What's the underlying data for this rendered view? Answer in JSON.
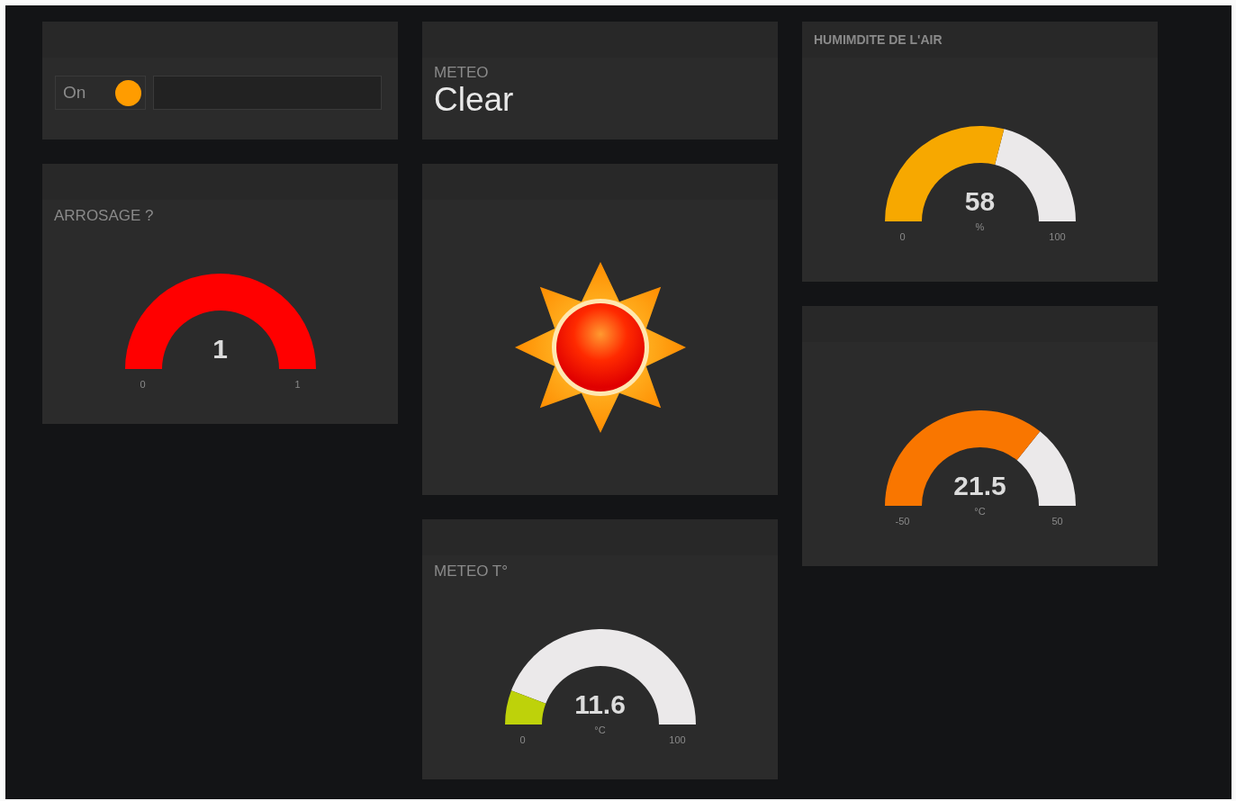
{
  "columns": [
    {
      "cards": [
        {
          "kind": "switch",
          "label": "On",
          "on": true
        },
        {
          "kind": "gauge",
          "title": "ARROSAGE ?",
          "value": "1",
          "min": "0",
          "max": "1",
          "color": "#ff0000"
        }
      ]
    },
    {
      "cards": [
        {
          "kind": "text",
          "label": "METEO",
          "value": "Clear"
        },
        {
          "kind": "weather_icon"
        },
        {
          "kind": "gauge",
          "title": "METEO T°",
          "value": "11.6",
          "unit": "°C",
          "min": "0",
          "max": "100",
          "color": "#bed20a"
        }
      ]
    },
    {
      "cards": [
        {
          "kind": "gauge",
          "header": "HUMIMDITE DE L'AIR",
          "value": "58",
          "unit": "%",
          "min": "0",
          "max": "100",
          "color": "#f7a800"
        },
        {
          "kind": "gauge",
          "value": "21.5",
          "unit": "°C",
          "min": "-50",
          "max": "50",
          "color": "#f97600"
        }
      ]
    }
  ]
}
